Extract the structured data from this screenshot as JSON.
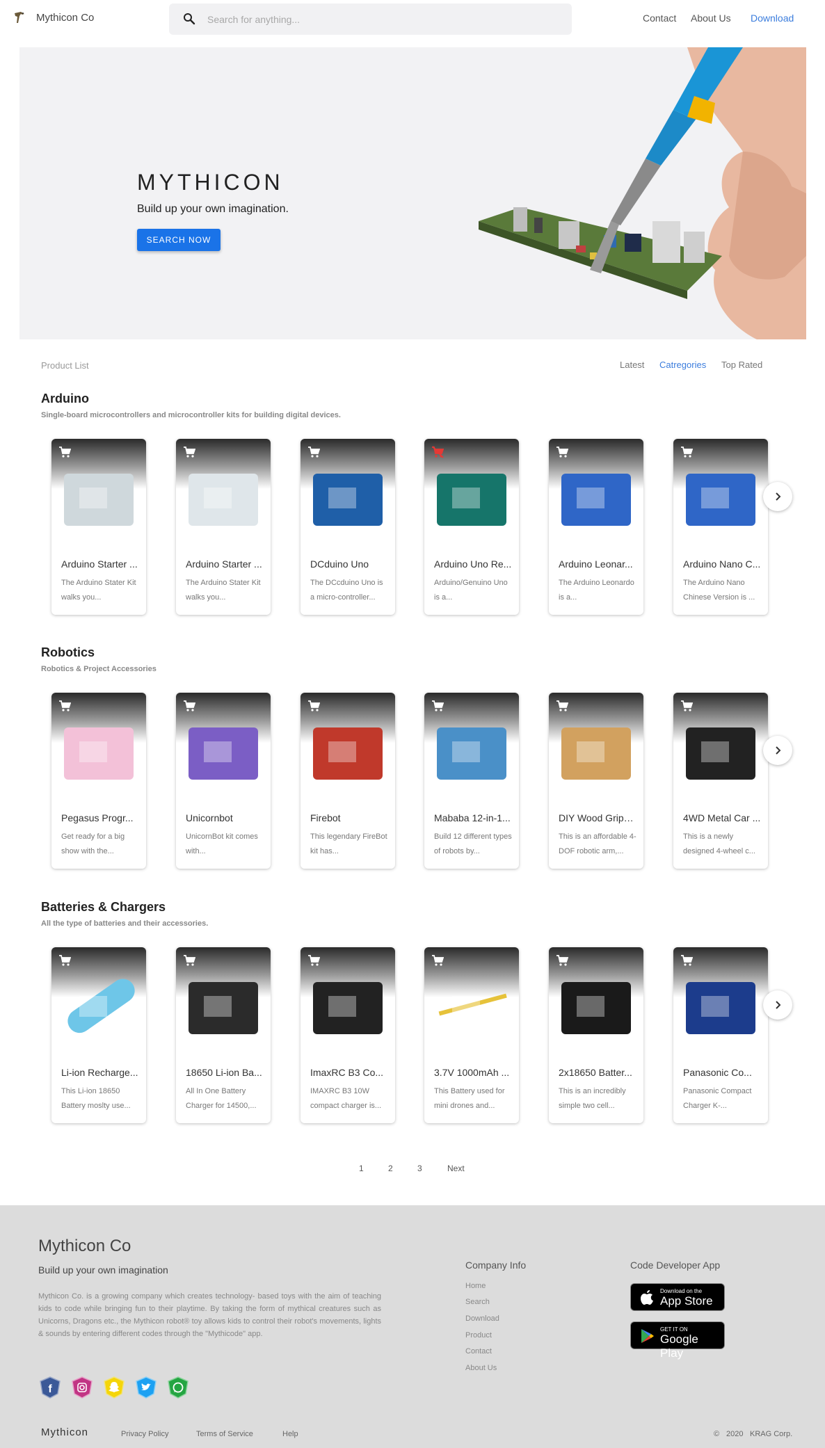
{
  "header": {
    "logo_text": "Mythicon Co",
    "search_placeholder": "Search for anything...",
    "nav": {
      "contact": "Contact",
      "about": "About Us",
      "download": "Download"
    }
  },
  "hero": {
    "title": "MYTHICON",
    "subtitle": "Build up your own imagination.",
    "button": "SEARCH NOW"
  },
  "product_list": {
    "label": "Product List",
    "tabs": {
      "latest": "Latest",
      "categories": "Catregories",
      "top_rated": "Top Rated"
    }
  },
  "sections": [
    {
      "title": "Arduino",
      "desc": "Single-board microcontrollers and microcontroller kits for building digital devices.",
      "cards": [
        {
          "name": "Arduino Starter ...",
          "desc": "The Arduino Stater Kit walks you...",
          "cart": "add"
        },
        {
          "name": "Arduino Starter ...",
          "desc": "The Arduino Stater Kit walks you...",
          "cart": "add"
        },
        {
          "name": "DCduino Uno",
          "desc": "The DCcduino Uno is a micro-controller...",
          "cart": "add"
        },
        {
          "name": "Arduino Uno Re...",
          "desc": "Arduino/Genuino Uno is a...",
          "cart": "remove"
        },
        {
          "name": "Arduino Leonar...",
          "desc": "The Arduino Leonardo is a...",
          "cart": "add"
        },
        {
          "name": "Arduino Nano C...",
          "desc": "The Arduino Nano Chinese Version is ...",
          "cart": "add"
        }
      ]
    },
    {
      "title": "Robotics",
      "desc": "Robotics & Project Accessories",
      "cards": [
        {
          "name": "Pegasus Progr...",
          "desc": "Get ready for a big show with the...",
          "cart": "add"
        },
        {
          "name": "Unicornbot",
          "desc": "UnicornBot kit comes with...",
          "cart": "add"
        },
        {
          "name": "Firebot",
          "desc": "This legendary FireBot kit has...",
          "cart": "add"
        },
        {
          "name": "Mababa 12-in-1...",
          "desc": "Build 12 different types of robots by...",
          "cart": "add"
        },
        {
          "name": "DIY Wood Gripp...",
          "desc": "This is an affordable 4-DOF robotic arm,...",
          "cart": "add"
        },
        {
          "name": "4WD Metal Car ...",
          "desc": "This is a newly designed 4-wheel c...",
          "cart": "add"
        }
      ]
    },
    {
      "title": "Batteries & Chargers",
      "desc": "All the type of batteries and their accessories.",
      "cards": [
        {
          "name": "Li-ion Recharge...",
          "desc": "This Li-ion 18650 Battery moslty use...",
          "cart": "add"
        },
        {
          "name": "18650 Li-ion Ba...",
          "desc": "All In One Battery Charger for 14500,...",
          "cart": "add"
        },
        {
          "name": "ImaxRC B3 Co...",
          "desc": "IMAXRC B3 10W compact charger is...",
          "cart": "add"
        },
        {
          "name": "3.7V 1000mAh ...",
          "desc": "This Battery used for mini drones and...",
          "cart": "add"
        },
        {
          "name": "2x18650 Batter...",
          "desc": "This is an incredibly simple two cell...",
          "cart": "add"
        },
        {
          "name": "Panasonic Co...",
          "desc": "Panasonic Compact Charger K-...",
          "cart": "add"
        }
      ]
    }
  ],
  "pagination": {
    "p1": "1",
    "p2": "2",
    "p3": "3",
    "next": "Next"
  },
  "footer": {
    "brand": "Mythicon Co",
    "tagline": "Build up your own imagination",
    "about": "Mythicon Co. is a growing company which creates technology- based toys with the aim of teaching kids to code while bringing fun to their playtime. By taking the form of mythical creatures such as Unicorns, Dragons etc., the Mythicon robot® toy allows kids to control their robot's movements, lights & sounds by entering different codes through the \"Mythicode\" app.",
    "company_info": {
      "heading": "Company Info",
      "links": [
        "Home",
        "Search",
        "Download",
        "Product",
        "Contact",
        "About Us"
      ]
    },
    "app": {
      "heading": "Code Developer App",
      "appstore_small": "Download on the",
      "appstore_big": "App Store",
      "googleplay_small": "GET IT ON",
      "googleplay_big": "Google Play"
    },
    "bottom": {
      "brand": "Mythicon",
      "privacy": "Privacy Policy",
      "terms": "Terms of Service",
      "help": "Help",
      "copyright_symbol": "©",
      "year": "2020",
      "corp": "KRAG Corp."
    },
    "social_icons": [
      "facebook-icon",
      "instagram-icon",
      "snapchat-icon",
      "twitter-icon",
      "whatsapp-icon"
    ]
  },
  "colors": {
    "accent": "#1a73e8",
    "link": "#3b7ddd",
    "footer_bg": "#dcdcdc",
    "remove_cart": "#e53935"
  }
}
